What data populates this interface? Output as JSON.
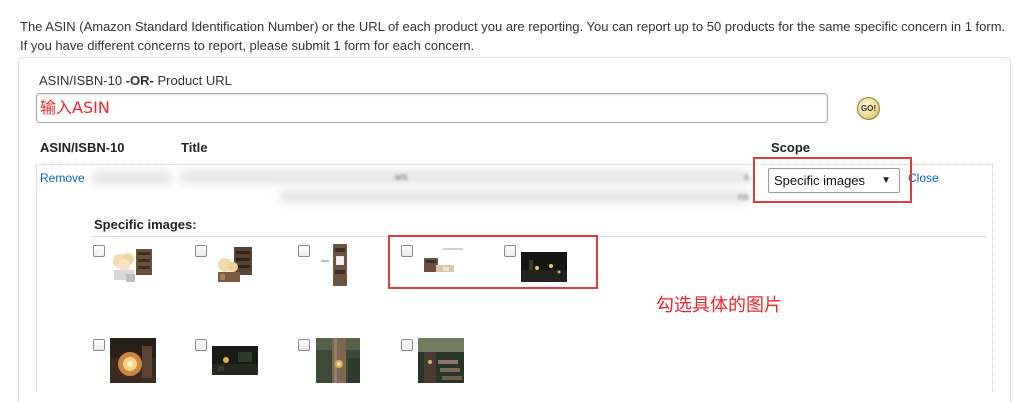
{
  "intro": {
    "text": "The ASIN (Amazon Standard Identification Number) or the URL of each product you are reporting. You can report up to 50 products for the same specific concern in 1 form. If you have different concerns to report, please submit 1 form for each concern."
  },
  "asin_field": {
    "label_prefix": "ASIN/ISBN-10 ",
    "label_or": "-OR-",
    "label_suffix": " Product URL",
    "value": "输入ASIN",
    "go_label": "GO!"
  },
  "table": {
    "headers": {
      "asin": "ASIN/ISBN-10",
      "title": "Title",
      "scope": "Scope"
    },
    "row": {
      "remove_label": "Remove",
      "close_label": "Close",
      "title_fragments": [
        "ws",
        "s",
        "ns"
      ],
      "scope_value": "Specific images"
    }
  },
  "specific_images": {
    "label": "Specific images:",
    "thumbnails": [
      {
        "name": "flower-crate-thumb",
        "checked": false
      },
      {
        "name": "wall-planter-thumb",
        "checked": false
      },
      {
        "name": "hanging-lantern-thumb",
        "checked": false
      },
      {
        "name": "shelf-product-thumb",
        "checked": false
      },
      {
        "name": "night-scene-thumb",
        "checked": false
      },
      {
        "name": "glowing-lantern-thumb",
        "checked": false
      },
      {
        "name": "dark-patio-thumb",
        "checked": false
      },
      {
        "name": "wooden-post-thumb",
        "checked": false
      },
      {
        "name": "garden-steps-thumb",
        "checked": false
      }
    ]
  },
  "annotation": {
    "text": "勾选具体的图片"
  },
  "colors": {
    "annotation_red": "#e8252a",
    "link_blue": "#0066c0"
  }
}
